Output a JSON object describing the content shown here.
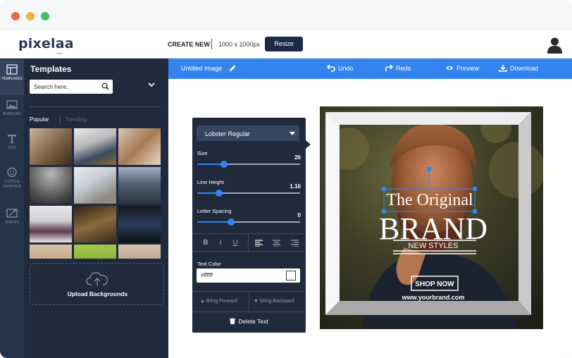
{
  "window": {
    "buttons": [
      "close",
      "minimize",
      "maximize"
    ]
  },
  "header": {
    "logo": "pixelaa",
    "logo_sub": "beta",
    "create_new": "CREATE NEW",
    "dimensions": "1000 x 1000px",
    "resize_label": "Resize",
    "avatar_icon": "user-avatar-icon"
  },
  "iconbar": {
    "items": [
      {
        "label": "TEMPLATES",
        "icon": "templates-icon",
        "active": true
      },
      {
        "label": "BGROUND",
        "icon": "background-icon",
        "active": false
      },
      {
        "label": "TEXT",
        "icon": "text-icon",
        "active": false
      },
      {
        "label": "ICONS & GRAPHICS",
        "icon": "graphics-icon",
        "active": false
      },
      {
        "label": "SHAPES",
        "icon": "shapes-icon",
        "active": false
      }
    ]
  },
  "panel": {
    "title": "Templates",
    "search_placeholder": "Search here..",
    "tabs": {
      "popular": "Popular",
      "trending": "Trending"
    },
    "upload_label": "Upload Backgrounds"
  },
  "toolbar": {
    "file_name": "Untitled Image",
    "undo": "Undo",
    "redo": "Redo",
    "preview": "Preview",
    "download": "Download"
  },
  "text_props": {
    "font": "Lobster Regular",
    "size_label": "Size",
    "size_value": "26",
    "size_fraction": 0.26,
    "line_height_label": "Line Height",
    "line_height_value": "1.16",
    "line_height_fraction": 0.21,
    "letter_spacing_label": "Letter Spacing",
    "letter_spacing_value": "0",
    "letter_spacing_fraction": 0.33,
    "format_buttons": [
      "B",
      "I",
      "U"
    ],
    "text_color_label": "Text Color",
    "text_color_value": "#ffffff",
    "bring_forward": "Bring Forward",
    "bring_backward": "Bring Backward",
    "delete_label": "Delete Text"
  },
  "design": {
    "headline": "The Original",
    "brand": "BRAND",
    "subline": "NEW STYLES",
    "cta": "SHOP NOW",
    "url": "www.yourbrand.com"
  },
  "colors": {
    "accent": "#3384ee",
    "sidebar": "#1f2b3d",
    "iconbar": "#263449",
    "resize_btn": "#1b2b45"
  }
}
